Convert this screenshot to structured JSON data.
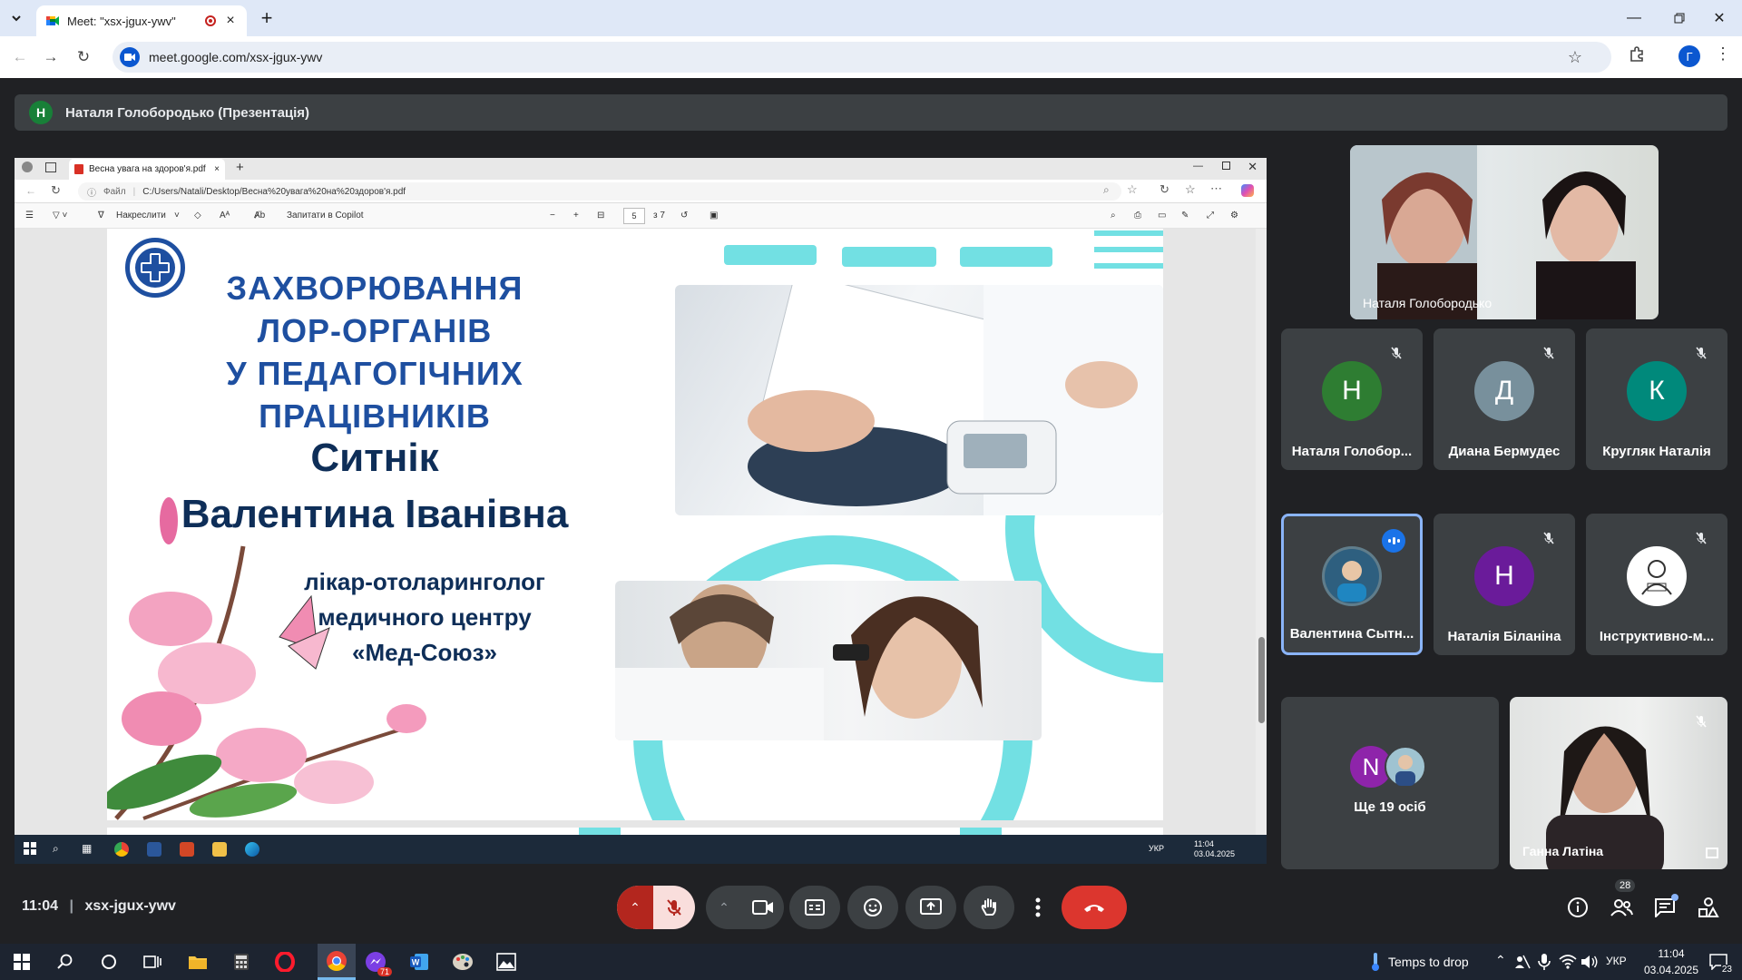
{
  "browser": {
    "tab_title": "Meet: \"xsx-jgux-ywv\"",
    "new_tab": "+",
    "url": "meet.google.com/xsx-jgux-ywv",
    "profile_letter": "Г"
  },
  "meet": {
    "presenter_initial": "Н",
    "presenter_label": "Наталя Голобородько (Презентація)",
    "time": "11:04",
    "code": "xsx-jgux-ywv",
    "participant_count": "28"
  },
  "shared_screen": {
    "edge_tab_title": "Весна увага на здоров'я.pdf",
    "edge_file_label": "Файл",
    "edge_url": "C:/Users/Natali/Desktop/Весна%20увага%20на%20здоров'я.pdf",
    "pdf_draw_label": "Накреслити",
    "pdf_copilot_label": "Запитати в Copilot",
    "pdf_page": "5",
    "pdf_page_total": "з 7",
    "slide": {
      "title_line1": "ЗАХВОРЮВАННЯ",
      "title_line2": "ЛОР-ОРГАНІВ",
      "title_line3": "У ПЕДАГОГІЧНИХ ПРАЦІВНИКІВ",
      "name_line1": "Ситнік",
      "name_line2": "Валентина Іванівна",
      "role_line1": "лікар-отоларинголог",
      "role_line2": "медичного центру",
      "role_line3": "«Мед-Союз»"
    },
    "taskbar_lang": "УКР",
    "taskbar_time": "11:04",
    "taskbar_date": "03.04.2025"
  },
  "tiles": [
    {
      "name": "Наталя Голобородько",
      "type": "video"
    },
    {
      "name": "Наталя Голобор...",
      "initial": "Н",
      "color": "#2e7d32",
      "muted": true
    },
    {
      "name": "Диана Бермудес",
      "initial": "Д",
      "color": "#78909c",
      "muted": true
    },
    {
      "name": "Кругляк Наталія",
      "initial": "К",
      "color": "#00897b",
      "muted": true
    },
    {
      "name": "Валентина Сытн...",
      "initial": "",
      "color": "#607d8b",
      "speaking": true
    },
    {
      "name": "Наталія Біланіна",
      "initial": "Н",
      "color": "#6a1b9a",
      "muted": true
    },
    {
      "name": "Інструктивно-м...",
      "initial": "",
      "color": "#ffffff",
      "muted": true
    },
    {
      "name": "Ще 19 осіб",
      "initial": "N",
      "color": "#8e24aa"
    },
    {
      "name": "Ганна Латіна",
      "type": "video",
      "muted": true
    }
  ],
  "os": {
    "temp_label": "Temps to drop",
    "lang": "УКР",
    "time": "11:04",
    "date": "03.04.2025",
    "notif_count": "23",
    "messenger_badge": "71"
  }
}
